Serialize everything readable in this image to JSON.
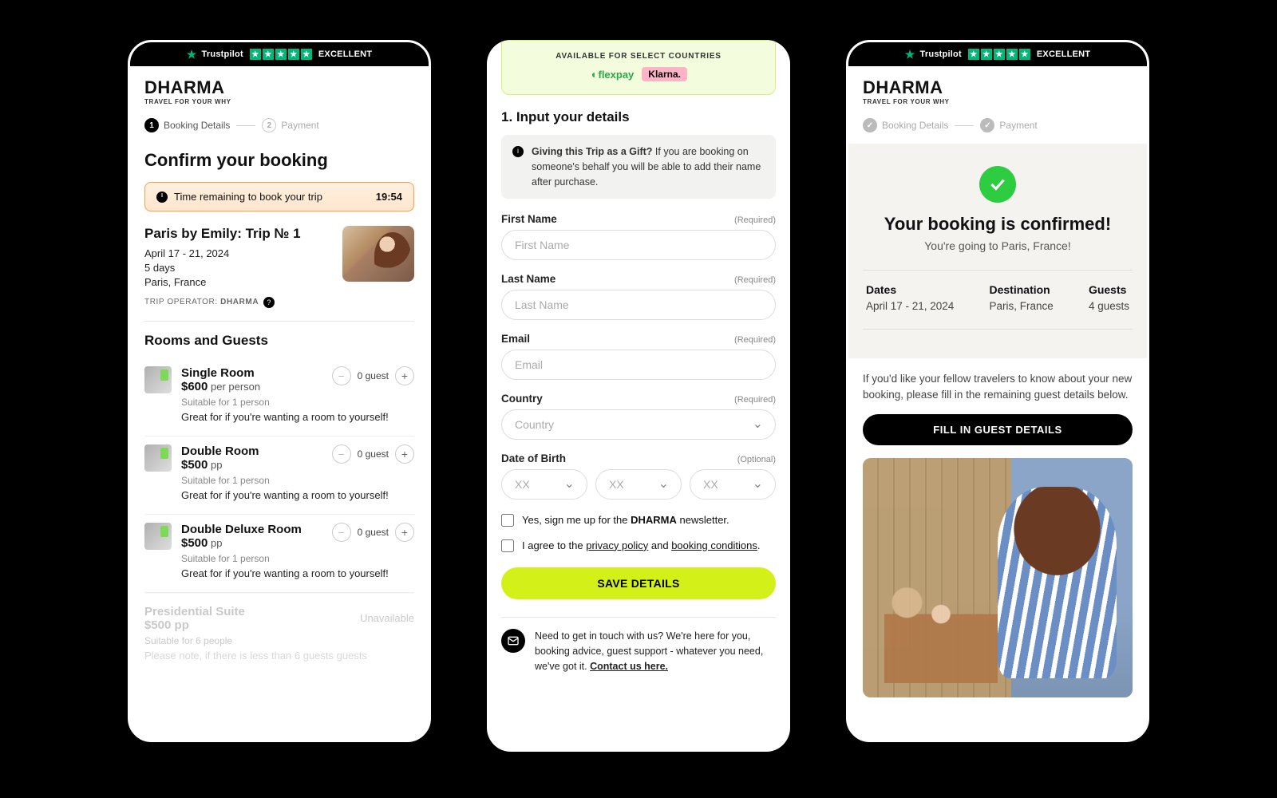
{
  "trustpilot": {
    "brand": "Trustpilot",
    "rating_label": "EXCELLENT"
  },
  "brand": {
    "logo": "DHARMA",
    "tagline": "TRAVEL FOR YOUR WHY"
  },
  "stepper": {
    "step1_num": "1",
    "step1_label": "Booking Details",
    "step2_num": "2",
    "step2_label": "Payment"
  },
  "p1": {
    "title": "Confirm your booking",
    "timer_label": "Time remaining to book your trip",
    "timer_value": "19:54",
    "trip_name": "Paris by Emily: Trip № 1",
    "trip_dates": "April 17 - 21, 2024",
    "trip_duration": "5 days",
    "trip_location": "Paris, France",
    "operator_prefix": "TRIP OPERATOR: ",
    "operator_name": "DHARMA",
    "rooms_title": "Rooms and Guests",
    "rooms": [
      {
        "name": "Single Room",
        "price": "$600",
        "per": " per person",
        "suitable": "Suitable for 1 person",
        "desc": "Great for if you're wanting a room to yourself!",
        "guests": "0 guest"
      },
      {
        "name": "Double Room",
        "price": "$500",
        "per": " pp",
        "suitable": "Suitable for 1 person",
        "desc": "Great for if you're wanting a room to yourself!",
        "guests": "0 guest"
      },
      {
        "name": "Double Deluxe Room",
        "price": "$500",
        "per": " pp",
        "suitable": "Suitable for 1 person",
        "desc": "Great for if you're wanting a room to yourself!",
        "guests": "0 guest"
      }
    ],
    "unavail": {
      "name": "Presidential Suite",
      "price": "$500 pp",
      "suitable": "Suitable for 6 people",
      "note": "Please note, if there is less than 6 guests guests",
      "tag": "Unavailable"
    }
  },
  "p2": {
    "avail_label": "AVAILABLE FOR SELECT COUNTRIES",
    "flexpay": "flexpay",
    "klarna": "Klarna.",
    "form_title": "1. Input your details",
    "gift_bold": "Giving this Trip as a Gift?",
    "gift_rest": " If you are booking on someone's behalf you will be able to add their name after purchase.",
    "required": "(Required)",
    "optional": "(Optional)",
    "labels": {
      "first": "First Name",
      "last": "Last Name",
      "email": "Email",
      "country": "Country",
      "dob": "Date of Birth"
    },
    "placeholders": {
      "first": "First Name",
      "last": "Last Name",
      "email": "Email",
      "country": "Country",
      "xx": "XX"
    },
    "news_pre": "Yes, sign me up for the ",
    "news_brand": "DHARMA",
    "news_post": " newsletter.",
    "agree_pre": "I agree to the ",
    "agree_pp": "privacy policy",
    "agree_and": " and ",
    "agree_bc": "booking conditions",
    "agree_dot": ".",
    "save_btn": "SAVE DETAILS",
    "contact_text": "Need to get in touch with us? We're here for you, booking advice, guest support - whatever you need, we've got it. ",
    "contact_link": "Contact us here."
  },
  "p3": {
    "title": "Your booking is confirmed!",
    "subtitle": "You're going to Paris, France!",
    "cols": {
      "dates_h": "Dates",
      "dates_v": "April 17 - 21, 2024",
      "dest_h": "Destination",
      "dest_v": "Paris, France",
      "guests_h": "Guests",
      "guests_v": "4 guests"
    },
    "share": "If you'd like your fellow travelers to know about your new booking, please fill in the remaining guest details below.",
    "guest_btn": "FILL IN GUEST DETAILS"
  }
}
